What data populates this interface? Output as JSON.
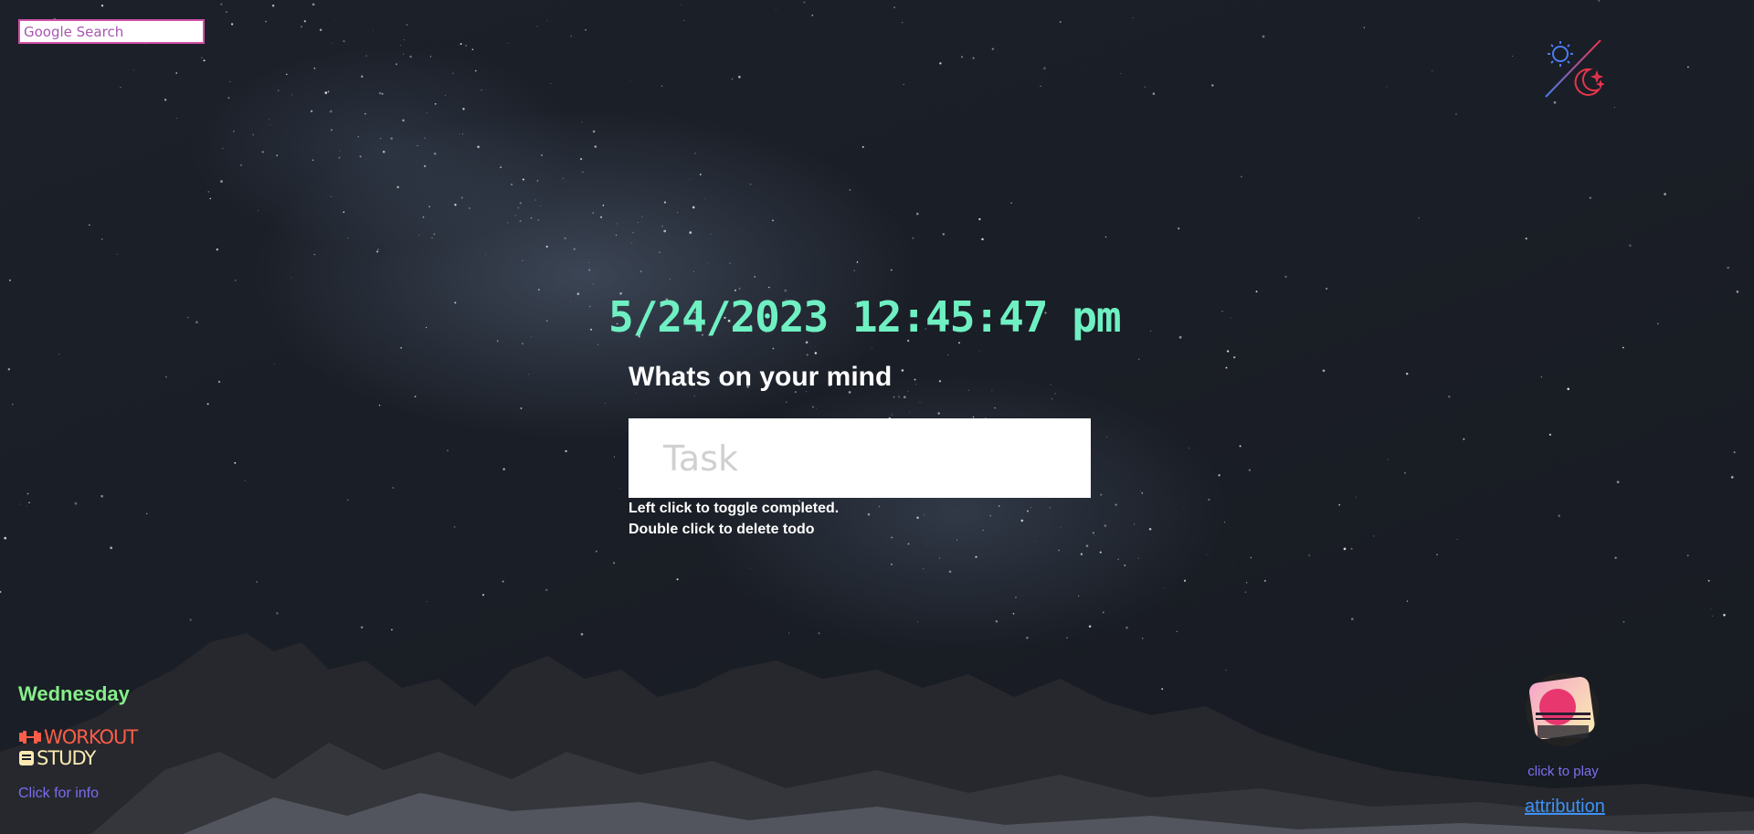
{
  "search": {
    "placeholder": "Google Search"
  },
  "theme_toggle": {
    "icons": [
      "sun-icon",
      "moon-icon"
    ],
    "colors": {
      "sun": "#4a7cf0",
      "moon": "#e8344d"
    }
  },
  "clock": {
    "text": "5/24/2023 12:45:47 pm",
    "color": "#6ff0c3"
  },
  "todo": {
    "title": "Whats on your mind",
    "input_placeholder": "Task",
    "hint_toggle": "Left click to toggle completed.",
    "hint_delete": "Double click to delete todo"
  },
  "schedule": {
    "day": "Wednesday",
    "items": [
      {
        "icon": "dumbbell-icon",
        "label": "WORKOUT",
        "color": "#fb5d48"
      },
      {
        "icon": "book-icon",
        "label": "STUDY",
        "color": "#fdeab2"
      }
    ],
    "info_link": "Click for info"
  },
  "player": {
    "album_icon": "album-art-icon",
    "play_text": "click to play",
    "attribution": "attribution"
  }
}
